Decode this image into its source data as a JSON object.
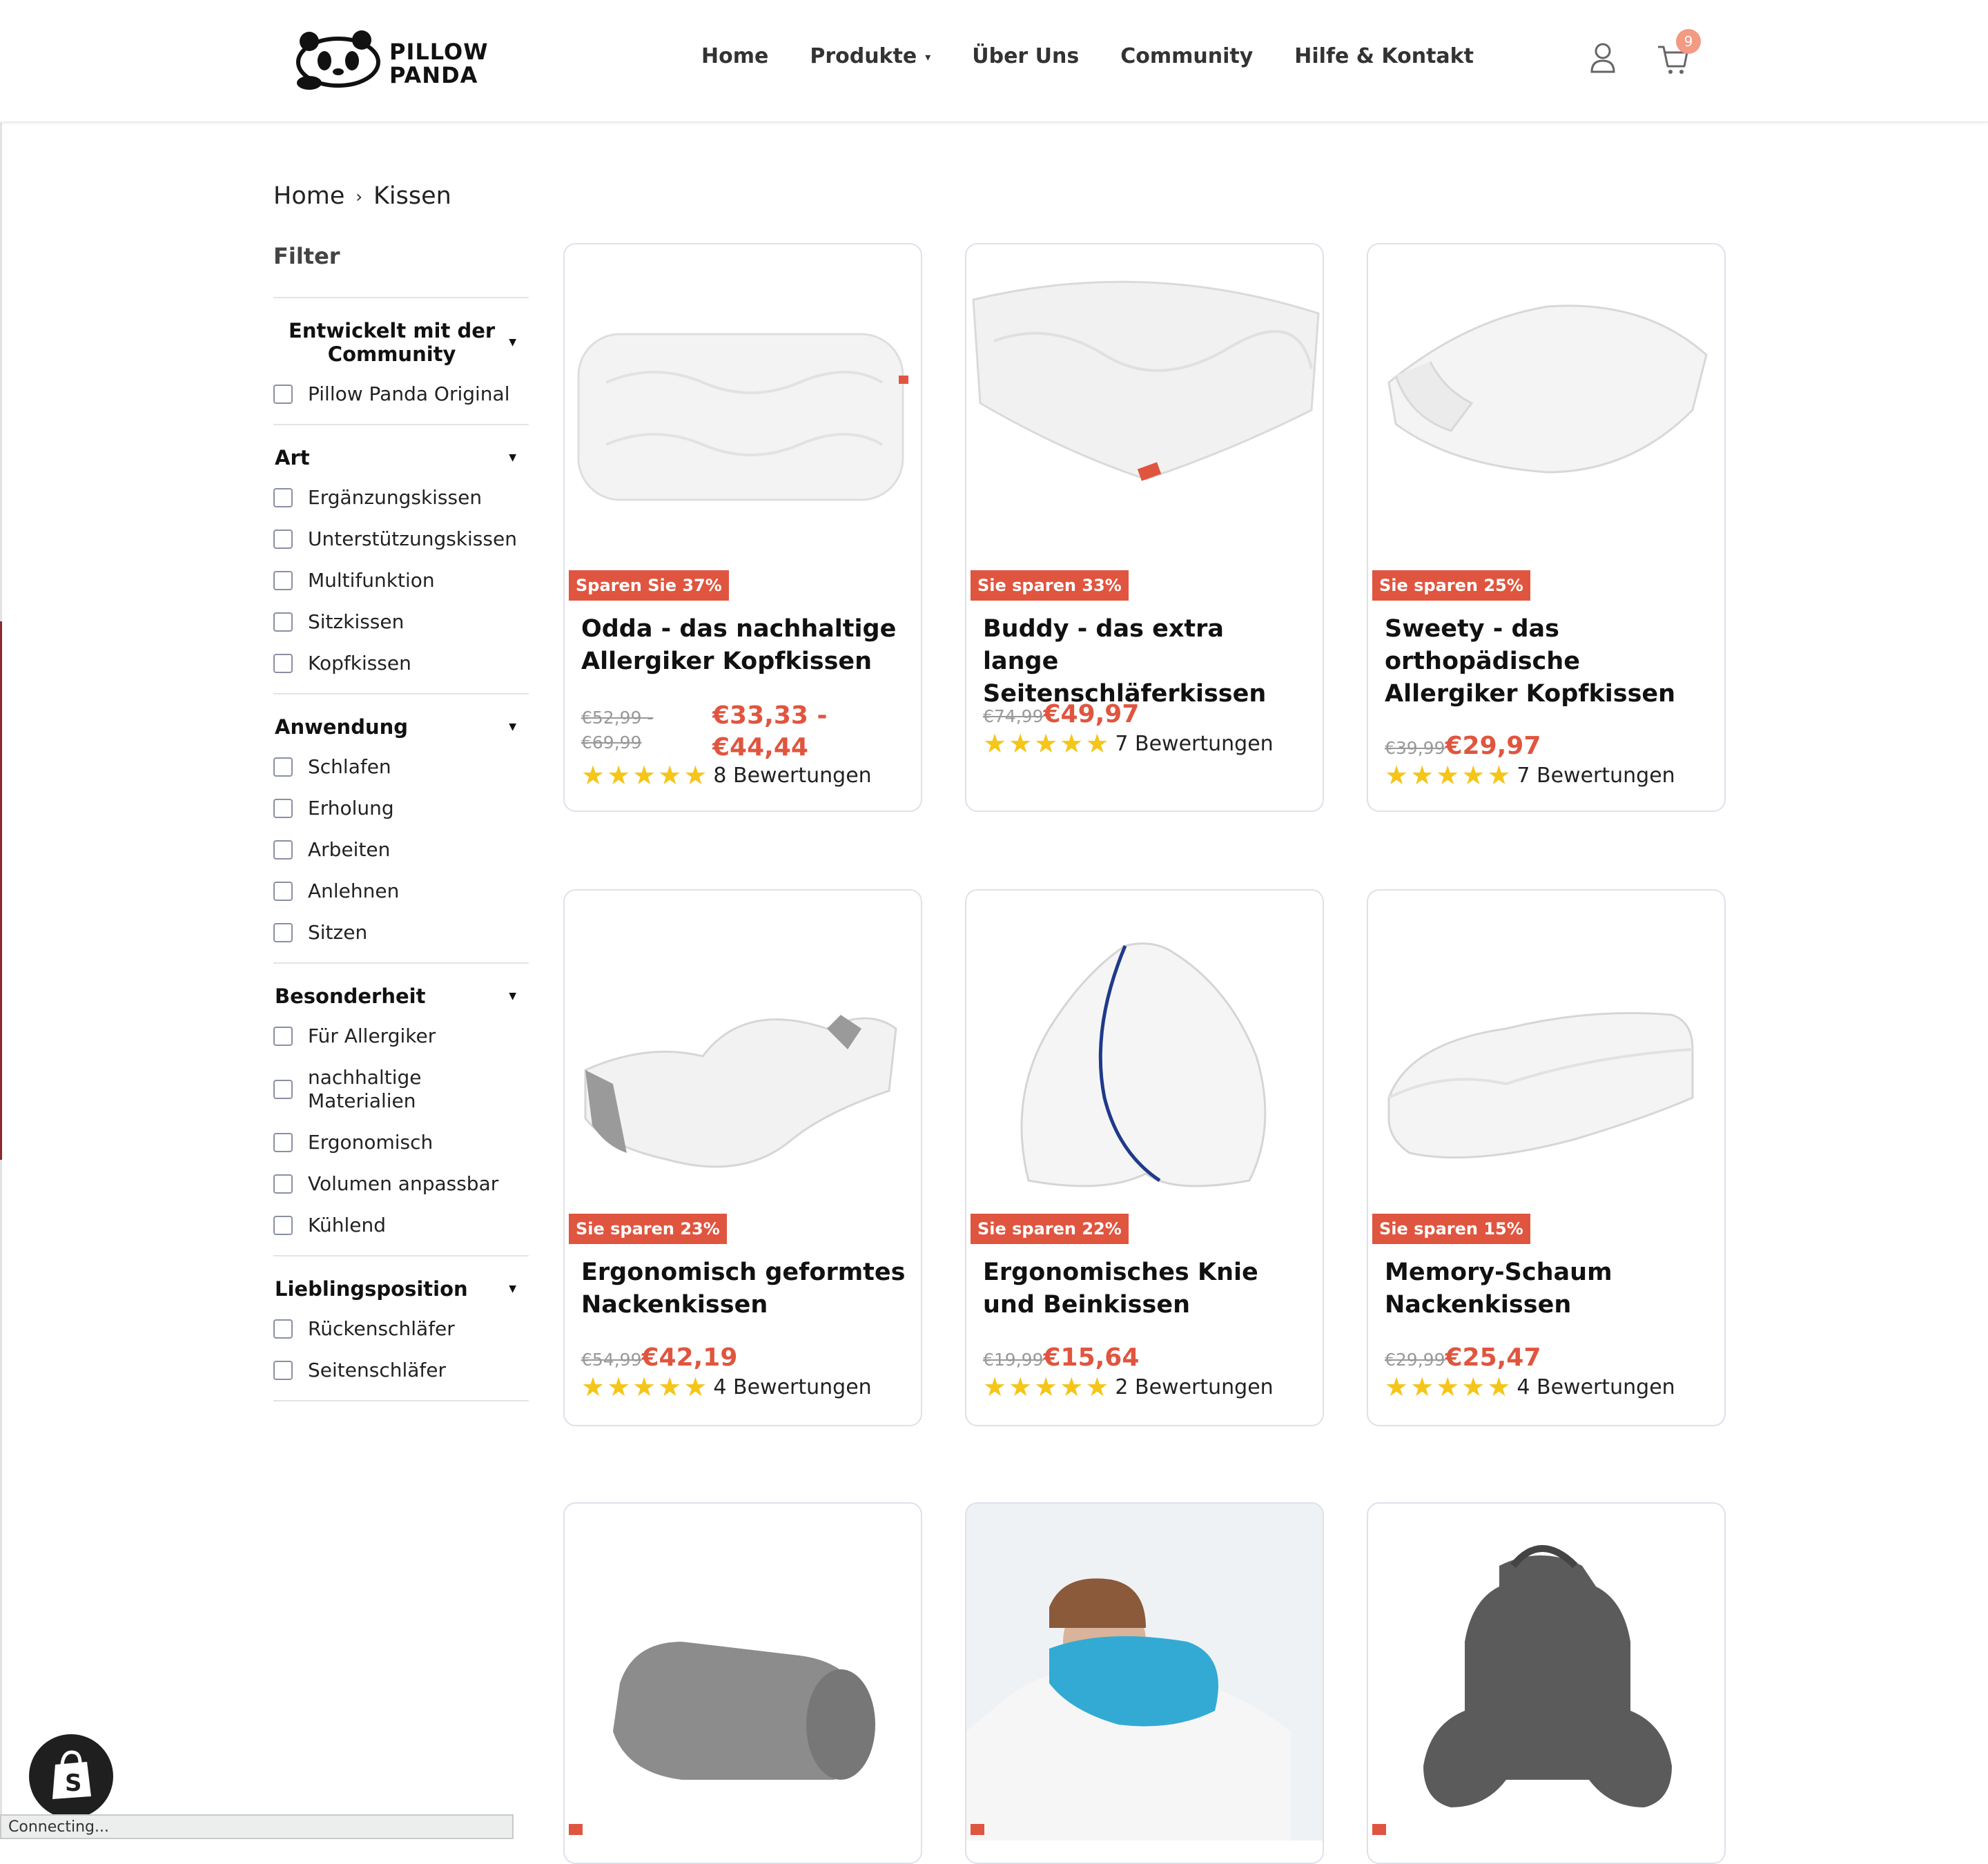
{
  "header": {
    "logo_text": [
      "PILLOW",
      "PANDA"
    ],
    "nav": [
      {
        "label": "Home"
      },
      {
        "label": "Produkte",
        "has_dropdown": true
      },
      {
        "label": "Über Uns"
      },
      {
        "label": "Community"
      },
      {
        "label": "Hilfe & Kontakt"
      }
    ],
    "cart_count": "9"
  },
  "breadcrumb": {
    "home": "Home",
    "current": "Kissen"
  },
  "filter": {
    "title": "Filter",
    "groups": [
      {
        "title": "Entwickelt mit der Community",
        "options": [
          "Pillow Panda Original"
        ]
      },
      {
        "title": "Art",
        "options": [
          "Ergänzungskissen",
          "Unterstützungskissen",
          "Multifunktion",
          "Sitzkissen",
          "Kopfkissen"
        ]
      },
      {
        "title": "Anwendung",
        "options": [
          "Schlafen",
          "Erholung",
          "Arbeiten",
          "Anlehnen",
          "Sitzen"
        ]
      },
      {
        "title": "Besonderheit",
        "options": [
          "Für Allergiker",
          "nachhaltige Materialien",
          "Ergonomisch",
          "Volumen anpassbar",
          "Kühlend"
        ]
      },
      {
        "title": "Lieblingsposition",
        "options": [
          "Rückenschläfer",
          "Seitenschläfer"
        ]
      }
    ]
  },
  "products": [
    {
      "badge": "Sparen Sie 37%",
      "title": "Odda - das nachhaltige Allergiker Kopfkissen",
      "old_price": "€52,99 - €69,99",
      "price": "€33,33 - €44,44",
      "rating": 5,
      "reviews": "8 Bewertungen"
    },
    {
      "badge": "Sie sparen 33%",
      "title": "Buddy - das extra lange Seitenschläferkissen",
      "old_price": "€74,99",
      "price": "€49,97",
      "rating": 5,
      "reviews": "7 Bewertungen"
    },
    {
      "badge": "Sie sparen 25%",
      "title": "Sweety - das orthopädische Allergiker Kopfkissen",
      "old_price": "€39,99",
      "price": "€29,97",
      "rating": 5,
      "reviews": "7 Bewertungen"
    },
    {
      "badge": "Sie sparen 23%",
      "title": "Ergonomisch geformtes Nackenkissen",
      "old_price": "€54,99",
      "price": "€42,19",
      "rating": 5,
      "reviews": "4 Bewertungen"
    },
    {
      "badge": "Sie sparen 22%",
      "title": "Ergonomisches Knie und Beinkissen",
      "old_price": "€19,99",
      "price": "€15,64",
      "rating": 5,
      "reviews": "2 Bewertungen"
    },
    {
      "badge": "Sie sparen 15%",
      "title": "Memory-Schaum Nackenkissen",
      "old_price": "€29,99",
      "price": "€25,47",
      "rating": 5,
      "reviews": "4 Bewertungen"
    },
    {
      "badge": "",
      "title": "",
      "old_price": "",
      "price": "",
      "rating": 0,
      "reviews": ""
    },
    {
      "badge": "",
      "title": "",
      "old_price": "",
      "price": "",
      "rating": 0,
      "reviews": ""
    },
    {
      "badge": "",
      "title": "",
      "old_price": "",
      "price": "",
      "rating": 0,
      "reviews": ""
    }
  ],
  "status_bar": "Connecting..."
}
